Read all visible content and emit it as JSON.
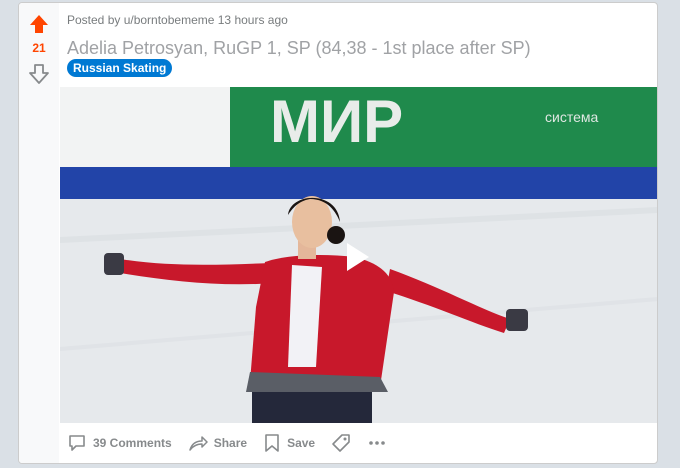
{
  "post": {
    "score": "21",
    "posted_by": "Posted by u/borntobememe 13 hours ago",
    "title": "Adelia Petrosyan, RuGP 1, SP (84,38 - 1st place after SP)",
    "flair": "Russian Skating",
    "banner_text": "МИР",
    "banner_sub": "система"
  },
  "actions": {
    "comments": "39 Comments",
    "share": "Share",
    "save": "Save"
  },
  "colors": {
    "upvote": "#ff4500",
    "flair_bg": "#0079d3",
    "banner_green": "#1f8a4c",
    "rink_blue": "#2244a8",
    "costume_red": "#c8182b"
  },
  "icons": {
    "upvote": "upvote-arrow-icon",
    "downvote": "downvote-arrow-icon",
    "comments": "comment-bubble-icon",
    "share": "share-arrow-icon",
    "save": "bookmark-icon",
    "tag": "tag-icon",
    "more": "more-dots-icon",
    "play": "play-icon"
  }
}
